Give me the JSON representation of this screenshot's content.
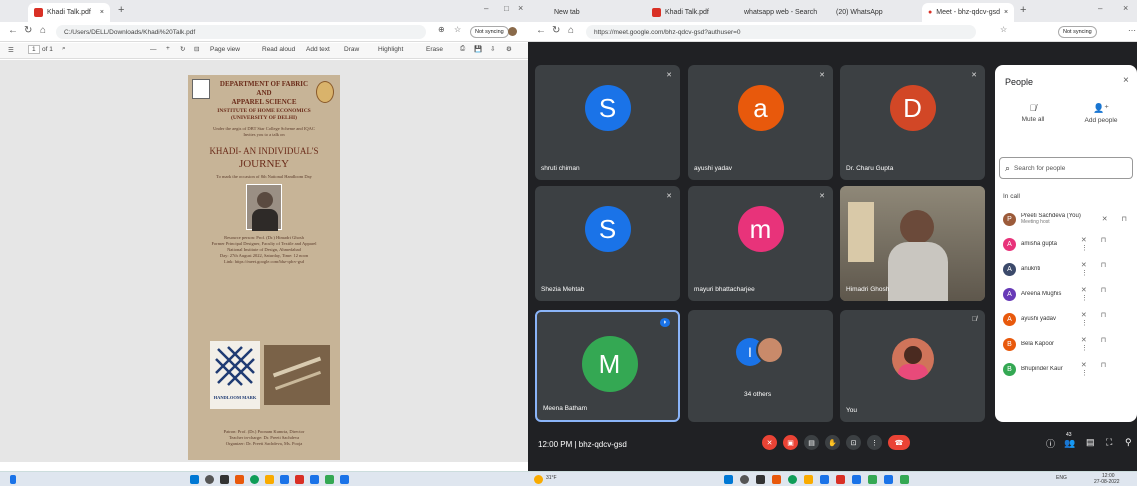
{
  "left": {
    "tab_title": "Khadi Talk.pdf",
    "url": "C:/Users/DELL/Downloads/Khadi%20Talk.pdf",
    "page_no": "1",
    "page_total": "of 1",
    "toolbar": [
      "Page view",
      "Read aloud",
      "Add text",
      "Draw",
      "Highlight",
      "Erase"
    ],
    "not_syncing": "Not syncing",
    "poster": {
      "dept": [
        "DEPARTMENT OF FABRIC",
        "AND",
        "APPAREL SCIENCE"
      ],
      "inst": [
        "INSTITUTE OF HOME ECONOMICS",
        "(UNIVERSITY OF DELHI)"
      ],
      "aegis": [
        "Under the aegis of DBT Star College Scheme and IQAC",
        "Invites you to a talk on"
      ],
      "title": [
        "KHADI- AN INDIVIDUAL'S",
        "JOURNEY"
      ],
      "occasion": "To mark the occasion of 8th National Handloom Day",
      "speaker": [
        "Resource person: Prof. (Dr.) Himadri Ghosh",
        "Former Principal Designer, Faculty of Textile and Apparel",
        "National Institute of Design, Ahmedabad",
        "Day: 27th August 2022, Saturday, Time: 12 noon",
        "Link: https://meet.google.com/bhz-qdcv-gsd"
      ],
      "mark": "HANDLOOM MARK",
      "footer": [
        "Patron: Prof. (Dr.) Poonam Kumria, Director",
        "Teacher in-charge: Dr. Preeti Sachdeva",
        "Organizer: Dr. Preeti Sachdeva, Ms. Pooja"
      ]
    }
  },
  "right": {
    "tabs": [
      "New tab",
      "Khadi Talk.pdf",
      "whatsapp web - Search",
      "(20) WhatsApp",
      "Meet - bhz-qdcv-gsd"
    ],
    "url": "https://meet.google.com/bhz-qdcv-gsd?authuser=0",
    "not_syncing": "Not syncing",
    "tiles": [
      {
        "name": "shruti chiman",
        "letter": "S",
        "color": "#1a73e8"
      },
      {
        "name": "ayushi yadav",
        "letter": "a",
        "color": "#e8590c"
      },
      {
        "name": "Dr. Charu Gupta",
        "letter": "D",
        "color": "#d24726"
      },
      {
        "name": "Shezia Mehtab",
        "letter": "S",
        "color": "#1a73e8"
      },
      {
        "name": "mayuri bhattacharjee",
        "letter": "m",
        "color": "#e8337a"
      },
      {
        "name": "Himadri Ghosh",
        "letter": "",
        "color": ""
      },
      {
        "name": "Meena Batham",
        "letter": "M",
        "color": "#34a853"
      },
      {
        "name": "34 others",
        "letter": "I",
        "color": "#1a73e8"
      },
      {
        "name": "You",
        "letter": "",
        "color": ""
      }
    ],
    "time": "12:00 PM",
    "meeting_code": "bhz-qdcv-gsd",
    "participant_count": "43",
    "people": {
      "title": "People",
      "mute_all": "Mute all",
      "add_people": "Add people",
      "search_placeholder": "Search for people",
      "in_call": "In call",
      "list": [
        {
          "name": "Preeti Sachdeva (You)",
          "sub": "Meeting host",
          "color": "#9c5b3a"
        },
        {
          "name": "amisha gupta",
          "color": "#e8337a"
        },
        {
          "name": "anukriti",
          "color": "#3c4a6b"
        },
        {
          "name": "Areena Mughis",
          "color": "#673ab7"
        },
        {
          "name": "ayushi yadav",
          "color": "#e8590c"
        },
        {
          "name": "Bela Kapoor",
          "color": "#e8590c"
        },
        {
          "name": "Bhupinder Kaur",
          "color": "#34a853"
        }
      ]
    },
    "taskbar": {
      "weather": "31°F",
      "lang": "ENG",
      "time": "12:00",
      "date": "27-08-2022"
    }
  }
}
